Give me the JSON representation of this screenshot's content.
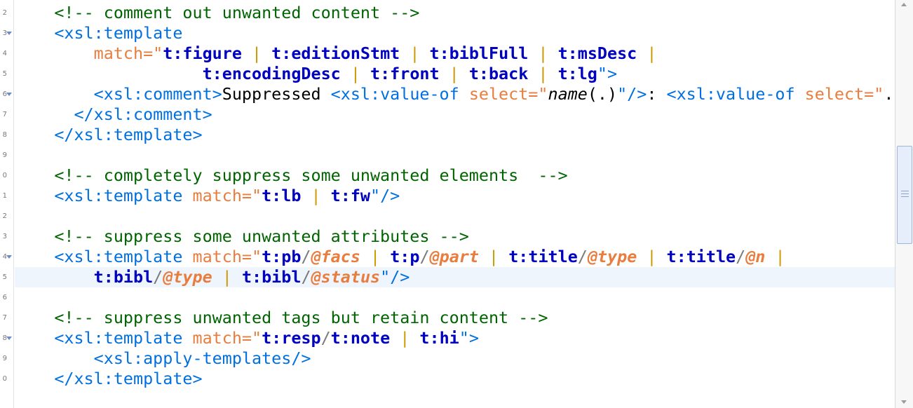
{
  "editor": {
    "line_numbers": [
      "2",
      "3",
      "4",
      "5",
      "6",
      "7",
      "8",
      "9",
      "0",
      "1",
      "2",
      "3",
      "4",
      "5",
      "6",
      "7",
      "8",
      "9",
      "0"
    ],
    "current_line_index": 13,
    "fold_marker_lines": [
      1,
      4,
      12,
      16
    ],
    "lines": [
      [
        {
          "t": "    ",
          "k": "text"
        },
        {
          "t": "<!-- comment out unwanted content -->",
          "k": "comment"
        }
      ],
      [
        {
          "t": "    ",
          "k": "text"
        },
        {
          "t": "<xsl:template",
          "k": "tag"
        }
      ],
      [
        {
          "t": "        ",
          "k": "text"
        },
        {
          "t": "match=\"",
          "k": "attr"
        },
        {
          "t": "t:figure",
          "k": "strong"
        },
        {
          "t": " | ",
          "k": "sep"
        },
        {
          "t": "t:editionStmt",
          "k": "strong"
        },
        {
          "t": " | ",
          "k": "sep"
        },
        {
          "t": "t:biblFull",
          "k": "strong"
        },
        {
          "t": " | ",
          "k": "sep"
        },
        {
          "t": "t:msDesc",
          "k": "strong"
        },
        {
          "t": " |",
          "k": "sep"
        }
      ],
      [
        {
          "t": "                ",
          "k": "text"
        },
        {
          "t": "   ",
          "k": "text"
        },
        {
          "t": "t:encodingDesc",
          "k": "strong"
        },
        {
          "t": " | ",
          "k": "sep"
        },
        {
          "t": "t:front",
          "k": "strong"
        },
        {
          "t": " | ",
          "k": "sep"
        },
        {
          "t": "t:back",
          "k": "strong"
        },
        {
          "t": " | ",
          "k": "sep"
        },
        {
          "t": "t:lg",
          "k": "strong"
        },
        {
          "t": "\">",
          "k": "tag"
        }
      ],
      [
        {
          "t": "        ",
          "k": "text"
        },
        {
          "t": "<xsl:comment>",
          "k": "tag"
        },
        {
          "t": "Suppressed ",
          "k": "text"
        },
        {
          "t": "<xsl:value-of ",
          "k": "tag"
        },
        {
          "t": "select=\"",
          "k": "attr"
        },
        {
          "t": "name",
          "k": "func"
        },
        {
          "t": "(.)",
          "k": "text"
        },
        {
          "t": "\"/>",
          "k": "tag"
        },
        {
          "t": ": ",
          "k": "text"
        },
        {
          "t": "<xsl:value-of ",
          "k": "tag"
        },
        {
          "t": "select=\"",
          "k": "attr"
        },
        {
          "t": ".\"",
          "k": "text"
        }
      ],
      [
        {
          "t": "      ",
          "k": "text"
        },
        {
          "t": "</xsl:comment>",
          "k": "tag"
        }
      ],
      [
        {
          "t": "    ",
          "k": "text"
        },
        {
          "t": "</xsl:template>",
          "k": "tag"
        }
      ],
      [],
      [
        {
          "t": "    ",
          "k": "text"
        },
        {
          "t": "<!-- completely suppress some unwanted elements  -->",
          "k": "comment"
        }
      ],
      [
        {
          "t": "    ",
          "k": "text"
        },
        {
          "t": "<xsl:template ",
          "k": "tag"
        },
        {
          "t": "match=\"",
          "k": "attr"
        },
        {
          "t": "t:lb",
          "k": "strong"
        },
        {
          "t": " | ",
          "k": "sep"
        },
        {
          "t": "t:fw",
          "k": "strong"
        },
        {
          "t": "\"/>",
          "k": "tag"
        }
      ],
      [],
      [
        {
          "t": "    ",
          "k": "text"
        },
        {
          "t": "<!-- suppress some unwanted attributes -->",
          "k": "comment"
        }
      ],
      [
        {
          "t": "    ",
          "k": "text"
        },
        {
          "t": "<xsl:template ",
          "k": "tag"
        },
        {
          "t": "match=\"",
          "k": "attr"
        },
        {
          "t": "t:pb",
          "k": "strong"
        },
        {
          "t": "/",
          "k": "slash"
        },
        {
          "t": "@facs",
          "k": "axis"
        },
        {
          "t": " | ",
          "k": "sep"
        },
        {
          "t": "t:p",
          "k": "strong"
        },
        {
          "t": "/",
          "k": "slash"
        },
        {
          "t": "@part",
          "k": "axis"
        },
        {
          "t": " | ",
          "k": "sep"
        },
        {
          "t": "t:title",
          "k": "strong"
        },
        {
          "t": "/",
          "k": "slash"
        },
        {
          "t": "@type",
          "k": "axis"
        },
        {
          "t": " | ",
          "k": "sep"
        },
        {
          "t": "t:title",
          "k": "strong"
        },
        {
          "t": "/",
          "k": "slash"
        },
        {
          "t": "@n",
          "k": "axis"
        },
        {
          "t": " |",
          "k": "sep"
        }
      ],
      [
        {
          "t": "        ",
          "k": "text"
        },
        {
          "t": "t:bibl",
          "k": "strong"
        },
        {
          "t": "/",
          "k": "slash"
        },
        {
          "t": "@type",
          "k": "axis"
        },
        {
          "t": " | ",
          "k": "sep"
        },
        {
          "t": "t:bibl",
          "k": "strong"
        },
        {
          "t": "/",
          "k": "slash"
        },
        {
          "t": "@status",
          "k": "axis"
        },
        {
          "t": "\"/>",
          "k": "tag"
        }
      ],
      [],
      [
        {
          "t": "    ",
          "k": "text"
        },
        {
          "t": "<!-- suppress unwanted tags but retain content -->",
          "k": "comment"
        }
      ],
      [
        {
          "t": "    ",
          "k": "text"
        },
        {
          "t": "<xsl:template ",
          "k": "tag"
        },
        {
          "t": "match=\"",
          "k": "attr"
        },
        {
          "t": "t:resp",
          "k": "strong"
        },
        {
          "t": "/",
          "k": "slash"
        },
        {
          "t": "t:note",
          "k": "strong"
        },
        {
          "t": " | ",
          "k": "sep"
        },
        {
          "t": "t:hi",
          "k": "strong"
        },
        {
          "t": "\">",
          "k": "tag"
        }
      ],
      [
        {
          "t": "        ",
          "k": "text"
        },
        {
          "t": "<xsl:apply-templates/>",
          "k": "tag"
        }
      ],
      [
        {
          "t": "    ",
          "k": "text"
        },
        {
          "t": "</xsl:template>",
          "k": "tag"
        }
      ]
    ]
  }
}
